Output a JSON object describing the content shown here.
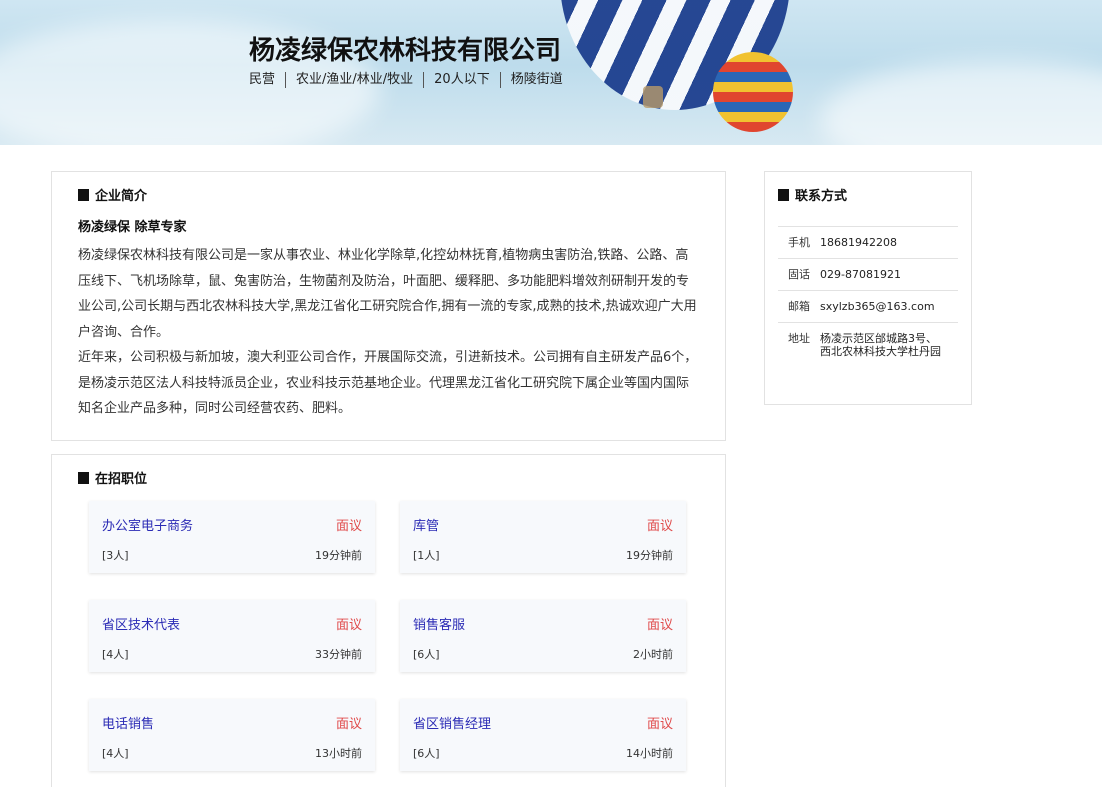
{
  "company": {
    "name": "杨凌绿保农林科技有限公司",
    "tags": [
      "民营",
      "农业/渔业/林业/牧业",
      "20人以下",
      "杨陵街道"
    ]
  },
  "intro": {
    "title": "企业简介",
    "slogan": "杨凌绿保 除草专家",
    "paragraphs": [
      "杨凌绿保农林科技有限公司是一家从事农业、林业化学除草,化控幼林抚育,植物病虫害防治,铁路、公路、高压线下、飞机场除草，鼠、兔害防治，生物菌剂及防治，叶面肥、缓释肥、多功能肥料增效剂研制开发的专业公司,公司长期与西北农林科技大学,黑龙江省化工研究院合作,拥有一流的专家,成熟的技术,热诚欢迎广大用户咨询、合作。",
      "近年来，公司积极与新加坡，澳大利亚公司合作，开展国际交流，引进新技术。公司拥有自主研发产品6个，是杨凌示范区法人科技特派员企业，农业科技示范基地企业。代理黑龙江省化工研究院下属企业等国内国际知名企业产品多种，同时公司经营农药、肥料。"
    ]
  },
  "jobs": {
    "title": "在招职位",
    "items": [
      {
        "title": "办公室电子商务",
        "salary": "面议",
        "count": "[3人]",
        "time": "19分钟前"
      },
      {
        "title": "库管",
        "salary": "面议",
        "count": "[1人]",
        "time": "19分钟前"
      },
      {
        "title": "省区技术代表",
        "salary": "面议",
        "count": "[4人]",
        "time": "33分钟前"
      },
      {
        "title": "销售客服",
        "salary": "面议",
        "count": "[6人]",
        "time": "2小时前"
      },
      {
        "title": "电话销售",
        "salary": "面议",
        "count": "[4人]",
        "time": "13小时前"
      },
      {
        "title": "省区销售经理",
        "salary": "面议",
        "count": "[6人]",
        "time": "14小时前"
      }
    ]
  },
  "contact": {
    "title": "联系方式",
    "rows": [
      {
        "label": "手机",
        "value": "18681942208"
      },
      {
        "label": "固话",
        "value": "029-87081921"
      },
      {
        "label": "邮箱",
        "value": "sxylzb365@163.com"
      },
      {
        "label": "地址",
        "value": "杨凌示范区邰城路3号、西北农林科技大学杜丹园"
      }
    ]
  }
}
